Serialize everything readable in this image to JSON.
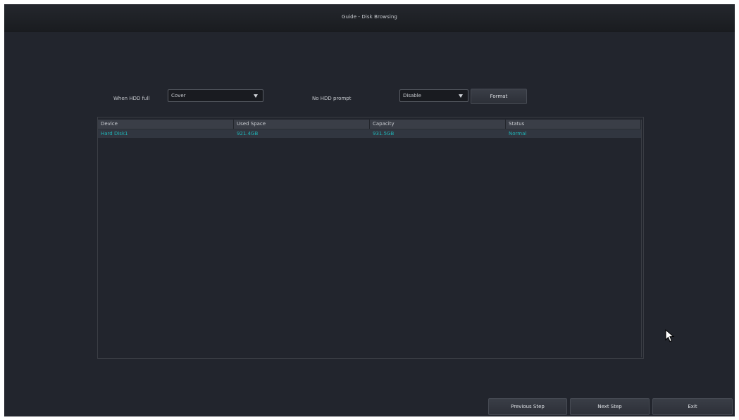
{
  "header": {
    "title": "Guide - Disk Browsing"
  },
  "controls": {
    "hdd_full_label": "When HDD full",
    "hdd_full_value": "Cover",
    "no_hdd_label": "No HDD prompt",
    "no_hdd_value": "Disable",
    "format_label": "Format"
  },
  "table": {
    "columns": [
      "Device",
      "Used Space",
      "Capacity",
      "Status"
    ],
    "rows": [
      {
        "device": "Hard Disk1",
        "used_space": "921.4GB",
        "capacity": "931.5GB",
        "status": "Normal"
      }
    ]
  },
  "footer": {
    "previous_label": "Previous Step",
    "next_label": "Next Step",
    "exit_label": "Exit"
  },
  "colors": {
    "background": "#22252d",
    "accent_text": "#1fb3b6",
    "header_row": "#3a3e47"
  }
}
